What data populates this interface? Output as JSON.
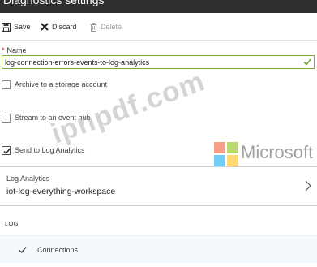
{
  "window": {
    "title": "Diagnostics settings"
  },
  "toolbar": {
    "save_label": "Save",
    "discard_label": "Discard",
    "delete_label": "Delete"
  },
  "form": {
    "name_label": "Name",
    "name_required_marker": "*",
    "name_value": "log-connection-errors-events-to-log-analytics",
    "archive_label": "Archive to a storage account",
    "archive_checked": false,
    "stream_label": "Stream to an event hub",
    "stream_checked": false,
    "send_label": "Send to Log Analytics",
    "send_checked": true
  },
  "log_analytics": {
    "label": "Log Analytics",
    "workspace": "iot-log-everything-workspace"
  },
  "log_section": {
    "header": "LOG",
    "items": [
      {
        "label": "Connections",
        "checked": true
      }
    ]
  },
  "overlays": {
    "watermark": "ipnpdf.com",
    "logo_text": "Microsoft"
  },
  "colors": {
    "title_bar": "#2f2f2f",
    "required": "#e00000",
    "valid_check": "#7aa83d",
    "log_row_bg": "#f3f9fd",
    "ms_red": "#f25022",
    "ms_green": "#7fba00",
    "ms_blue": "#00a4ef",
    "ms_yellow": "#ffb900"
  }
}
